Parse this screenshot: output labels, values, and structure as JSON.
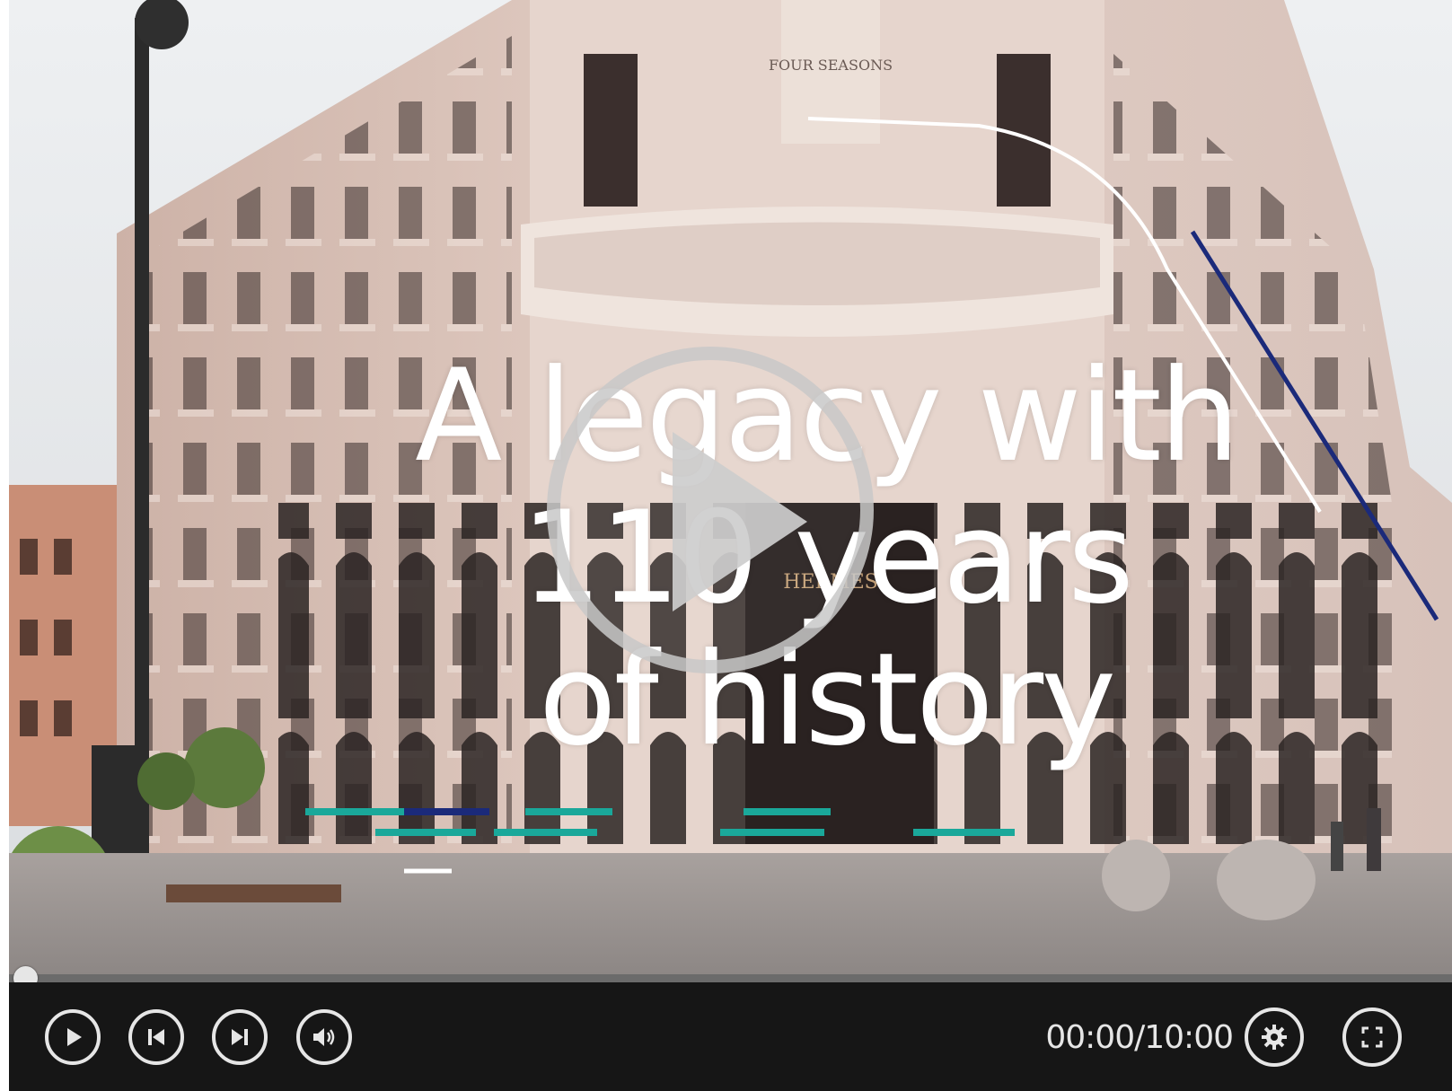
{
  "video": {
    "signage_top": "FOUR SEASONS",
    "signage_door": "HERMES",
    "title_lines": [
      "A legacy with",
      "110 years",
      "of history"
    ]
  },
  "playback": {
    "progress_fraction": 0.0,
    "current_time": "00:00",
    "separator": "/",
    "duration": "10:00"
  },
  "controls": {
    "play_icon": "play-icon",
    "prev_icon": "skip-previous-icon",
    "next_icon": "skip-next-icon",
    "volume_icon": "volume-icon",
    "settings_icon": "gear-icon",
    "fullscreen_icon": "fullscreen-icon"
  },
  "colors": {
    "overlay_teal": "#1aa89a",
    "overlay_navy": "#1b2a7a",
    "overlay_white": "#ffffff",
    "control_bar": "#161616",
    "control_icon": "#e6e6e6"
  }
}
